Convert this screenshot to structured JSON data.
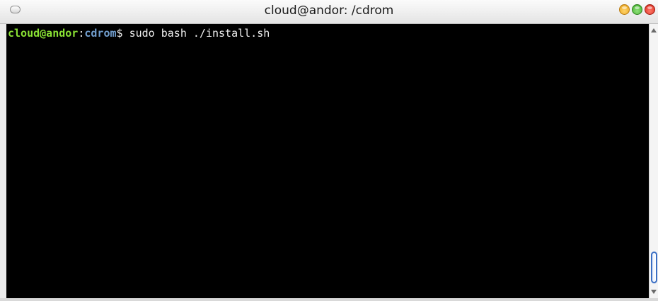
{
  "window": {
    "title": "cloud@andor: /cdrom"
  },
  "terminal": {
    "prompt_user_host": "cloud@andor",
    "prompt_separator": ":",
    "prompt_dir": "cdrom",
    "prompt_symbol": "$ ",
    "command": "sudo bash ./install.sh",
    "colors": {
      "background": "#000000",
      "user_host": "#8ae234",
      "directory": "#729fcf",
      "text": "#f0f0f0"
    }
  },
  "icons": {
    "menu": "window-menu-icon",
    "minimize": "minimize-icon",
    "maximize": "maximize-icon",
    "close": "close-icon",
    "scroll_up": "scroll-up-arrow-icon",
    "scroll_down": "scroll-down-arrow-icon"
  },
  "scrollbar": {
    "position": "bottom"
  }
}
